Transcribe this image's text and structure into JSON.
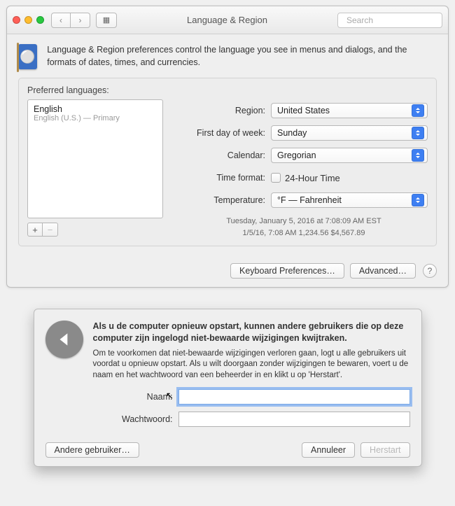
{
  "window1": {
    "title": "Language & Region",
    "search_placeholder": "Search",
    "intro": "Language & Region preferences control the language you see in menus and dialogs, and the formats of dates, times, and currencies.",
    "preferred_label": "Preferred languages:",
    "languages": [
      {
        "name": "English",
        "sub": "English (U.S.) — Primary"
      }
    ],
    "add_label": "+",
    "remove_label": "−",
    "rows": {
      "region_label": "Region:",
      "region_value": "United States",
      "firstday_label": "First day of week:",
      "firstday_value": "Sunday",
      "calendar_label": "Calendar:",
      "calendar_value": "Gregorian",
      "timeformat_label": "Time format:",
      "timeformat_cb": "24-Hour Time",
      "temperature_label": "Temperature:",
      "temperature_value": "°F — Fahrenheit"
    },
    "example_line1": "Tuesday, January 5, 2016 at 7:08:09 AM EST",
    "example_line2": "1/5/16, 7:08 AM    1,234.56    $4,567.89",
    "keyboard_btn": "Keyboard Preferences…",
    "advanced_btn": "Advanced…",
    "help_label": "?"
  },
  "dialog2": {
    "headline": "Als u de computer opnieuw opstart, kunnen andere gebruikers die op deze computer zijn ingelogd niet-bewaarde wijzigingen kwijtraken.",
    "body": "Om te voorkomen dat niet-bewaarde wijzigingen verloren gaan, logt u alle gebruikers uit voordat u opnieuw opstart. Als u wilt doorgaan zonder wijzigingen te bewaren, voert u de naam en het wachtwoord van een beheerder in en klikt u op 'Herstart'.",
    "name_label": "Naam:",
    "password_label": "Wachtwoord:",
    "other_user_btn": "Andere gebruiker…",
    "cancel_btn": "Annuleer",
    "restart_btn": "Herstart"
  }
}
